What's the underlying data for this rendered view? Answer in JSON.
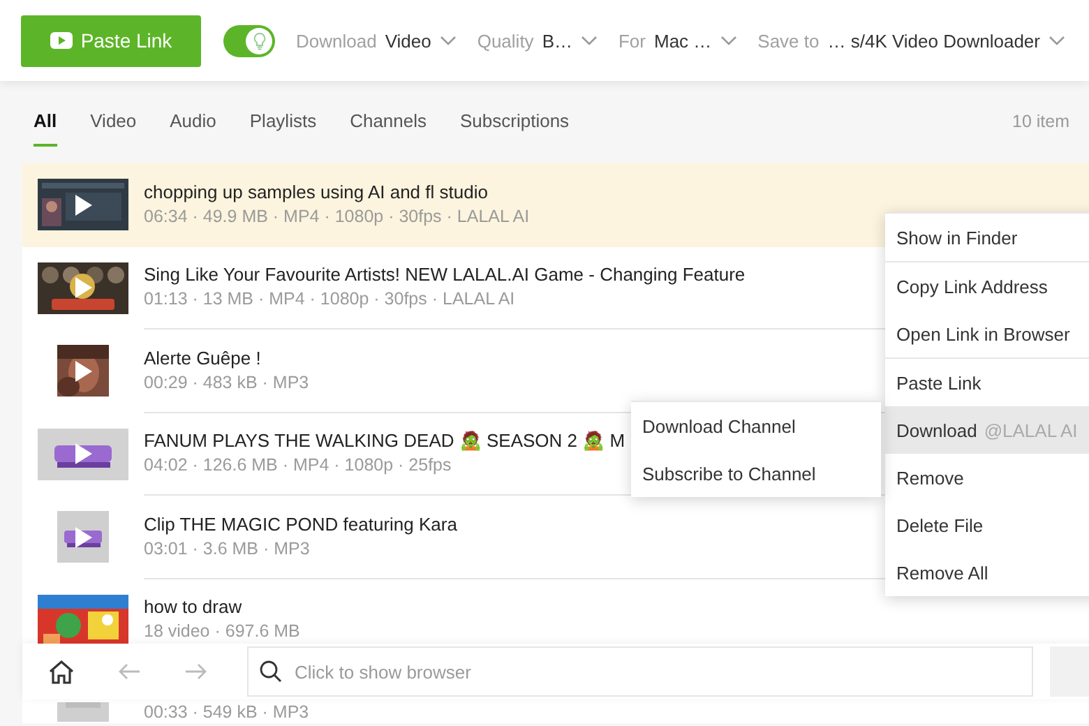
{
  "toolbar": {
    "paste_button": "Paste Link",
    "toggle": {
      "on": true
    },
    "dropdowns": [
      {
        "label": "Download",
        "value": "Video"
      },
      {
        "label": "Quality",
        "value": "B…"
      },
      {
        "label": "For",
        "value": "Mac …"
      },
      {
        "label": "Save to",
        "value": "… s/4K Video Downloader"
      }
    ]
  },
  "tabs": [
    {
      "label": "All",
      "selected": true
    },
    {
      "label": "Video",
      "selected": false
    },
    {
      "label": "Audio",
      "selected": false
    },
    {
      "label": "Playlists",
      "selected": false
    },
    {
      "label": "Channels",
      "selected": false
    },
    {
      "label": "Subscriptions",
      "selected": false
    }
  ],
  "item_count": "10 item",
  "items": [
    {
      "kind": "video",
      "title": "chopping up samples using AI and fl studio",
      "meta": "06:34 · 49.9 MB · MP4 · 1080p · 30fps · LALAL AI",
      "selected": true
    },
    {
      "kind": "video",
      "title": "Sing Like Your Favourite Artists! NEW LALAL.AI Game - Changing Feature",
      "meta": "01:13 · 13 MB · MP4 · 1080p · 30fps · LALAL AI",
      "selected": false
    },
    {
      "kind": "audio",
      "title": "Alerte Guêpe !",
      "meta": "00:29 · 483 kB · MP3",
      "selected": false
    },
    {
      "kind": "video",
      "title": "FANUM PLAYS THE WALKING DEAD 🧟 SEASON 2 🧟 M",
      "meta": "04:02 · 126.6 MB · MP4 · 1080p · 25fps",
      "selected": false
    },
    {
      "kind": "audio",
      "title": "Clip THE MAGIC POND featuring Kara",
      "meta": "03:01 · 3.6 MB · MP3",
      "selected": false
    },
    {
      "kind": "playlist",
      "title": "how to draw",
      "meta": "18 video · 697.6 MB",
      "selected": false
    },
    {
      "kind": "audio",
      "meta": "00:33 · 549 kB · MP3",
      "selected": false
    }
  ],
  "context_menu": {
    "groups": [
      [
        {
          "label": "Show in Finder",
          "highlighted": false
        }
      ],
      [
        {
          "label": "Copy Link Address",
          "highlighted": false
        },
        {
          "label": "Open Link in Browser",
          "highlighted": false
        }
      ],
      [
        {
          "label": "Paste Link",
          "highlighted": false
        },
        {
          "label": "Download",
          "detail": "@LALAL AI",
          "highlighted": true
        },
        {
          "label": "Remove",
          "highlighted": false
        },
        {
          "label": "Delete File",
          "highlighted": false
        },
        {
          "label": "Remove All",
          "highlighted": false
        }
      ]
    ]
  },
  "submenu": [
    {
      "label": "Download Channel",
      "highlighted": false
    },
    {
      "label": "Subscribe to Channel",
      "highlighted": false
    }
  ],
  "bottom_bar": {
    "search_placeholder": "Click to show browser"
  }
}
